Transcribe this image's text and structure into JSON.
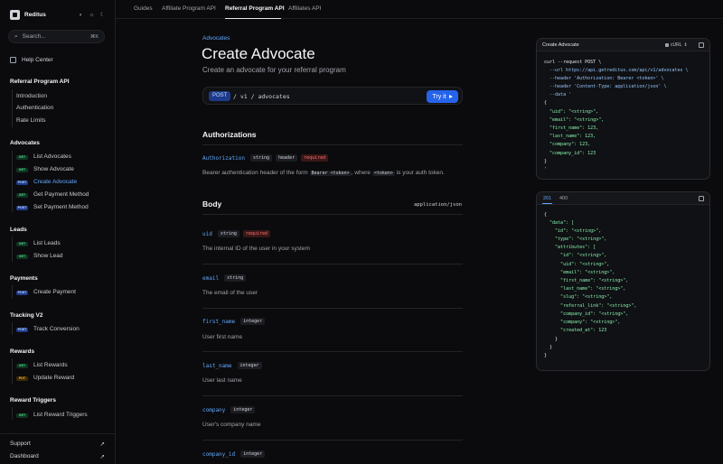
{
  "brand": {
    "name": "Reditus"
  },
  "search": {
    "placeholder": "Search...",
    "shortcut": "⌘K"
  },
  "sidebar": {
    "help_center": "Help Center",
    "groups": [
      {
        "title": "Referral Program API",
        "items": [
          "Introduction",
          "Authentication",
          "Rate Limits"
        ]
      },
      {
        "title": "Advocates",
        "items": [
          {
            "method": "GET",
            "label": "List Advocates"
          },
          {
            "method": "GET",
            "label": "Show Advocate"
          },
          {
            "method": "POST",
            "label": "Create Advocate"
          },
          {
            "method": "GET",
            "label": "Get Payment Method"
          },
          {
            "method": "POST",
            "label": "Set Payment Method"
          }
        ]
      },
      {
        "title": "Leads",
        "items": [
          {
            "method": "GET",
            "label": "List Leads"
          },
          {
            "method": "GET",
            "label": "Show Lead"
          }
        ]
      },
      {
        "title": "Payments",
        "items": [
          {
            "method": "POST",
            "label": "Create Payment"
          }
        ]
      },
      {
        "title": "Tracking V2",
        "items": [
          {
            "method": "POST",
            "label": "Track Conversion"
          }
        ]
      },
      {
        "title": "Rewards",
        "items": [
          {
            "method": "GET",
            "label": "List Rewards"
          },
          {
            "method": "PUT",
            "label": "Update Reward"
          }
        ]
      },
      {
        "title": "Reward Triggers",
        "items": [
          {
            "method": "GET",
            "label": "List Reward Triggers"
          }
        ]
      }
    ],
    "footer": [
      "Support",
      "Dashboard"
    ]
  },
  "topnav": {
    "tabs": [
      "Guides",
      "Affiliate Program API",
      "Referral Program API",
      "Affiliates API"
    ]
  },
  "page": {
    "breadcrumb": "Advocates",
    "title": "Create Advocate",
    "subtitle": "Create an advocate for your referral program",
    "method": "POST",
    "path_sep": "/",
    "path_v": "v1",
    "path_res": "advocates",
    "try_it": "Try it"
  },
  "authorizations": {
    "title": "Authorizations",
    "name": "Authorization",
    "type": "string",
    "location": "header",
    "required": "required",
    "desc_a": "Bearer authentication header of the form",
    "desc_code1": "Bearer <token>",
    "desc_b": ", where",
    "desc_code2": "<token>",
    "desc_c": "is your auth token."
  },
  "body": {
    "title": "Body",
    "content_type": "application/json",
    "params": [
      {
        "name": "uid",
        "type": "string",
        "required": "required",
        "desc": "The internal ID of the user in your system"
      },
      {
        "name": "email",
        "type": "string",
        "desc": "The email of the user"
      },
      {
        "name": "first_name",
        "type": "integer",
        "desc": "User first name"
      },
      {
        "name": "last_name",
        "type": "integer",
        "desc": "User last name"
      },
      {
        "name": "company",
        "type": "integer",
        "desc": "User's company name"
      },
      {
        "name": "company_id",
        "type": "integer"
      }
    ]
  },
  "request_panel": {
    "title": "Create Advocate",
    "lang": "cURL",
    "lines": [
      "curl --request POST \\",
      "  --url https://api.getreditus.com/api/v1/advocates \\",
      "  --header 'Authorization: Bearer <token>' \\",
      "  --header 'Content-Type: application/json' \\",
      "  --data '",
      "{",
      "  \"uid\": \"<string>\",",
      "  \"email\": \"<string>\",",
      "  \"first_name\": 123,",
      "  \"last_name\": 123,",
      "  \"company\": 123,",
      "  \"company_id\": 123",
      "}",
      "'"
    ]
  },
  "response_panel": {
    "tabs": [
      "201",
      "400"
    ],
    "lines": [
      "{",
      "  \"data\": [",
      "    \"id\": \"<string>\",",
      "    \"type\": \"<string>\",",
      "    \"attributes\": [",
      "      \"id\": \"<string>\",",
      "      \"uid\": \"<string>\",",
      "      \"email\": \"<string>\",",
      "      \"first_name\": \"<string>\",",
      "      \"last_name\": \"<string>\",",
      "      \"slug\": \"<string>\",",
      "      \"referral_link\": \"<string>\",",
      "      \"company_id\": \"<string>\",",
      "      \"company\": \"<string>\",",
      "      \"created_at\": 123",
      "    }",
      "  }",
      "}"
    ]
  },
  "colors": {
    "accent": "#60a5fa",
    "button": "#2563eb",
    "get": "#4ade80",
    "post": "#bfdbfe",
    "put": "#fbbf24",
    "required": "#f87171"
  }
}
